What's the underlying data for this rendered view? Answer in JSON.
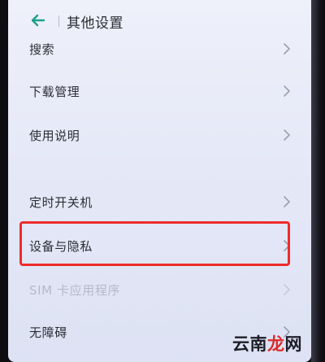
{
  "header": {
    "title": "其他设置",
    "back_icon": "arrow-left-icon"
  },
  "settings": {
    "items": [
      {
        "label": "搜索",
        "enabled": true,
        "chevron_icon": "chevron-right-icon"
      },
      {
        "label": "下载管理",
        "enabled": true,
        "chevron_icon": "chevron-right-icon"
      },
      {
        "label": "使用说明",
        "enabled": true,
        "chevron_icon": "chevron-right-icon"
      },
      {
        "label": "定时开关机",
        "enabled": true,
        "chevron_icon": "chevron-right-icon"
      },
      {
        "label": "设备与隐私",
        "enabled": true,
        "highlighted": true,
        "chevron_icon": "chevron-right-icon"
      },
      {
        "label": "SIM 卡应用程序",
        "enabled": false,
        "chevron_icon": "chevron-right-icon"
      },
      {
        "label": "无障碍",
        "enabled": true,
        "chevron_icon": "chevron-right-icon"
      }
    ]
  },
  "watermark": {
    "text_main": "云南",
    "text_accent": "龙",
    "text_tail": "网"
  },
  "colors": {
    "accent": "#1f9f8a",
    "highlight": "#ee2b2b",
    "watermark_accent": "#dc2a2a"
  }
}
